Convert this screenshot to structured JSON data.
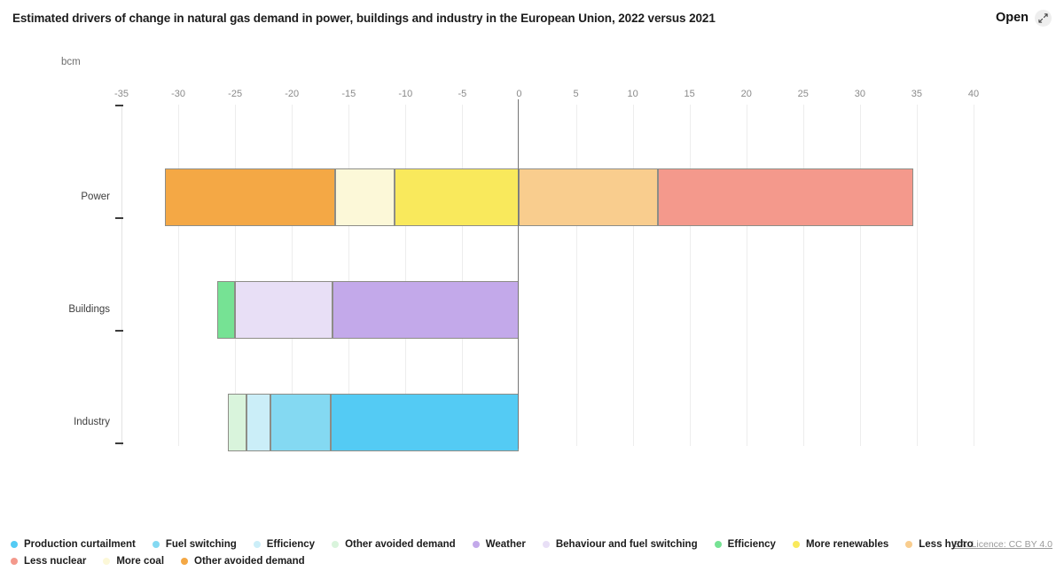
{
  "header": {
    "title": "Estimated drivers of change in natural gas demand in power, buildings and industry in the European Union, 2022 versus 2021",
    "open_label": "Open",
    "expand_icon": "expand-arrows-icon"
  },
  "footer": {
    "source": "IEA. Licence: CC BY 4.0"
  },
  "chart_data": {
    "type": "bar",
    "orientation": "horizontal",
    "stacked": true,
    "title": "Estimated drivers of change in natural gas demand in power, buildings and industry in the European Union, 2022 versus 2021",
    "xlabel": "",
    "ylabel": "bcm",
    "unit": "bcm",
    "xlim": [
      -35,
      40
    ],
    "xticks": [
      -35,
      -30,
      -25,
      -20,
      -15,
      -10,
      -5,
      0,
      5,
      10,
      15,
      20,
      25,
      30,
      35,
      40
    ],
    "xtick_labels": [
      "-35",
      "-30",
      "-25",
      "-20",
      "-15",
      "-10",
      "-5",
      "0",
      "5",
      "10",
      "15",
      "20",
      "25",
      "30",
      "35",
      "40"
    ],
    "categories": [
      "Power",
      "Buildings",
      "Industry"
    ],
    "grid": true,
    "legend_position": "bottom",
    "bars": [
      {
        "category": "Power",
        "segments": [
          {
            "name": "Other avoided demand",
            "start": -31.2,
            "end": -16.2,
            "value": -15.0,
            "color": "#f4a845"
          },
          {
            "name": "More coal",
            "start": -16.2,
            "end": -11.0,
            "value": -5.2,
            "color": "#fcf8d8"
          },
          {
            "name": "More renewables",
            "start": -11.0,
            "end": 0,
            "value": -11.0,
            "color": "#f9e95c"
          },
          {
            "name": "Less hydro",
            "start": 0,
            "end": 12.2,
            "value": 12.2,
            "color": "#f9cd8e"
          },
          {
            "name": "Less nuclear",
            "start": 12.2,
            "end": 34.7,
            "value": 22.5,
            "color": "#f4998c"
          }
        ]
      },
      {
        "category": "Buildings",
        "segments": [
          {
            "name": "Efficiency",
            "start": -26.6,
            "end": -25.0,
            "value": -1.6,
            "color": "#76e294"
          },
          {
            "name": "Behaviour and fuel switching",
            "start": -25.0,
            "end": -16.4,
            "value": -8.6,
            "color": "#e8dff6"
          },
          {
            "name": "Weather",
            "start": -16.4,
            "end": 0,
            "value": -16.4,
            "color": "#c3a9ea"
          }
        ]
      },
      {
        "category": "Industry",
        "segments": [
          {
            "name": "Other avoided demand",
            "start": -25.6,
            "end": -24.0,
            "value": -1.6,
            "color": "#d9f4dc"
          },
          {
            "name": "Efficiency",
            "start": -24.0,
            "end": -21.9,
            "value": -2.1,
            "color": "#cbeef8"
          },
          {
            "name": "Fuel switching",
            "start": -21.9,
            "end": -16.6,
            "value": -5.3,
            "color": "#84d9f2"
          },
          {
            "name": "Production curtailment",
            "start": -16.6,
            "end": 0,
            "value": -16.6,
            "color": "#54cbf4"
          }
        ]
      }
    ],
    "legend": [
      {
        "label": "Production curtailment",
        "color": "#54cbf4"
      },
      {
        "label": "Fuel switching",
        "color": "#84d9f2"
      },
      {
        "label": "Efficiency",
        "color": "#cbeef8"
      },
      {
        "label": "Other avoided demand",
        "color": "#d9f4dc"
      },
      {
        "label": "Weather",
        "color": "#c3a9ea"
      },
      {
        "label": "Behaviour and fuel switching",
        "color": "#e8dff6"
      },
      {
        "label": "Efficiency",
        "color": "#76e294"
      },
      {
        "label": "More renewables",
        "color": "#f9e95c"
      },
      {
        "label": "Less hydro",
        "color": "#f9cd8e"
      },
      {
        "label": "Less nuclear",
        "color": "#f4998c"
      },
      {
        "label": "More coal",
        "color": "#fcf8d8"
      },
      {
        "label": "Other avoided demand",
        "color": "#f4a845"
      }
    ]
  }
}
